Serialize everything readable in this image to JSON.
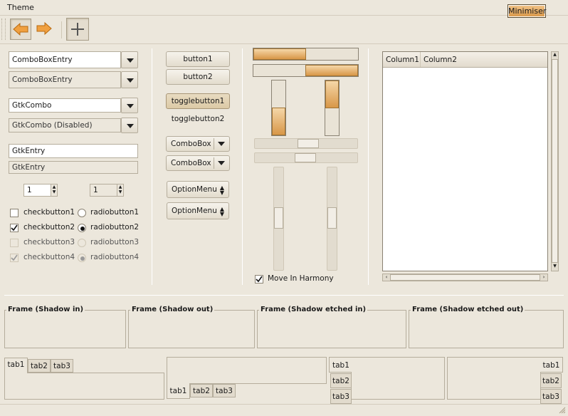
{
  "menubar": {
    "theme_label": "Theme",
    "minimiser_label": "Minimiser"
  },
  "toolbar": {
    "back_icon": "arrow-left-icon",
    "forward_icon": "arrow-right-icon",
    "add_icon": "plus-icon"
  },
  "left": {
    "combo_entries": [
      "ComboBoxEntry",
      "ComboBoxEntry"
    ],
    "gtk_combos": [
      "GtkCombo",
      "GtkCombo (Disabled)"
    ],
    "gtk_entries": [
      "GtkEntry",
      "GtkEntry"
    ],
    "spinners": [
      "1",
      "1"
    ],
    "checkbuttons": [
      "checkbutton1",
      "checkbutton2",
      "checkbutton3",
      "checkbutton4"
    ],
    "radiobuttons": [
      "radiobutton1",
      "radiobutton2",
      "radiobutton3",
      "radiobutton4"
    ]
  },
  "middle": {
    "buttons": [
      "button1",
      "button2"
    ],
    "togglebuttons": [
      "togglebutton1",
      "togglebutton2"
    ],
    "comboboxes": [
      "ComboBox",
      "ComboBox"
    ],
    "optionmenus": [
      "OptionMenu",
      "OptionMenu"
    ]
  },
  "progress": {
    "horizontal": [
      0.5,
      0.5
    ],
    "vertical": [
      0.5,
      0.5
    ]
  },
  "harmony_label": "Move In Harmony",
  "tree": {
    "columns": [
      "Column1",
      "Column2"
    ]
  },
  "frames": [
    "Frame (Shadow in)",
    "Frame (Shadow out)",
    "Frame (Shadow etched in)",
    "Frame (Shadow etched out)"
  ],
  "tabs": [
    "tab1",
    "tab2",
    "tab3"
  ]
}
